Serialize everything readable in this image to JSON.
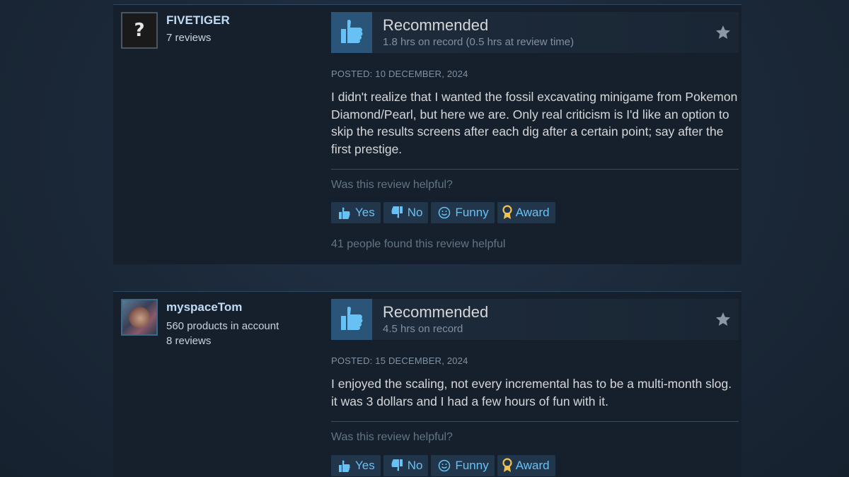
{
  "reviews": [
    {
      "author": {
        "name": "FIVETIGER",
        "reviews": "7 reviews",
        "avatar_icon": "question-mark-avatar"
      },
      "recommendation": "Recommended",
      "hours": "1.8 hrs on record (0.5 hrs at review time)",
      "posted": "POSTED: 10 DECEMBER, 2024",
      "text": "I didn't realize that I wanted the fossil excavating minigame from Pokemon Diamond/Pearl, but here we are. Only real criticism is I'd like an option to skip the results screens after each dig after a certain point; say after the first prestige.",
      "helpful_question": "Was this review helpful?",
      "buttons": {
        "yes": "Yes",
        "no": "No",
        "funny": "Funny",
        "award": "Award"
      },
      "helpful_count": "41 people found this review helpful"
    },
    {
      "author": {
        "name": "myspaceTom",
        "products": "560 products in account",
        "reviews": "8 reviews",
        "avatar_icon": "user-photo-avatar"
      },
      "recommendation": "Recommended",
      "hours": "4.5 hrs on record",
      "posted": "POSTED: 15 DECEMBER, 2024",
      "text": "I enjoyed the scaling, not every incremental has to be a multi-month slog. it was 3 dollars and I had a few hours of fun with it.",
      "helpful_question": "Was this review helpful?",
      "buttons": {
        "yes": "Yes",
        "no": "No",
        "funny": "Funny",
        "award": "Award"
      }
    }
  ],
  "colors": {
    "background": "#1b2838",
    "panel": "#16202d",
    "accent_blue": "#67c1f5",
    "thumb_box": "#2a5478",
    "award_gold": "#f2c14e"
  }
}
